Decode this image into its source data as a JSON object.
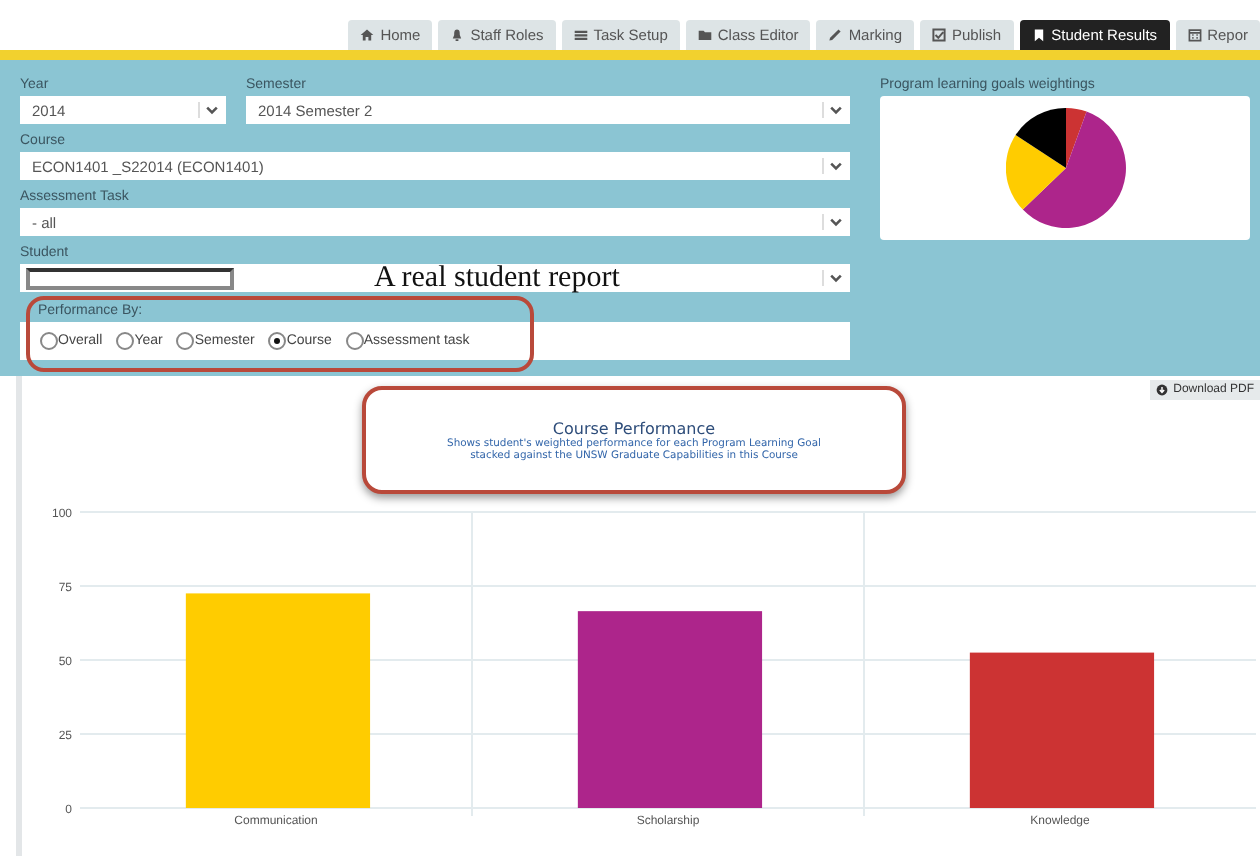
{
  "tabs": [
    {
      "label": "Home",
      "kind": "home",
      "selected": false
    },
    {
      "label": "Staff Roles",
      "kind": "bell",
      "selected": false
    },
    {
      "label": "Task Setup",
      "kind": "list",
      "selected": false
    },
    {
      "label": "Class Editor",
      "kind": "folder",
      "selected": false
    },
    {
      "label": "Marking",
      "kind": "pencil",
      "selected": false
    },
    {
      "label": "Publish",
      "kind": "checkbox",
      "selected": false
    },
    {
      "label": "Student Results",
      "kind": "bookmark",
      "selected": true
    },
    {
      "label": "Repor",
      "kind": "calendar",
      "selected": false
    }
  ],
  "filters": {
    "year": {
      "label": "Year",
      "value": "2014"
    },
    "semester": {
      "label": "Semester",
      "value": "2014 Semester 2"
    },
    "course": {
      "label": "Course",
      "value": "ECON1401 _S22014 (ECON1401)"
    },
    "assessment_task": {
      "label": "Assessment Task",
      "value": "- all"
    },
    "student": {
      "label": "Student"
    }
  },
  "overlay_caption": "A real student report",
  "performance_by": {
    "label": "Performance By:",
    "options": [
      {
        "label": "Overall",
        "selected": false
      },
      {
        "label": "Year",
        "selected": false
      },
      {
        "label": "Semester",
        "selected": false
      },
      {
        "label": "Course",
        "selected": true
      },
      {
        "label": "Assessment task",
        "selected": false
      }
    ]
  },
  "weightings": {
    "title": "Program learning goals weightings"
  },
  "download_button": "Download PDF",
  "chart": {
    "title": "Course Performance",
    "subtitle_lines": [
      "Shows student's weighted performance for each Program Learning Goal",
      "stacked against the UNSW Graduate Capabilities in this Course"
    ],
    "chart_data": {
      "type": "bar",
      "categories": [
        "Communication",
        "Scholarship",
        "Knowledge"
      ],
      "ylim": [
        0,
        100
      ],
      "yticks": [
        0,
        25,
        50,
        75,
        100
      ],
      "grid": true,
      "values": [
        72.5,
        66.5,
        52.5
      ],
      "colors": [
        "#ffcc00",
        "#ad258b",
        "#cc3333"
      ]
    }
  }
}
